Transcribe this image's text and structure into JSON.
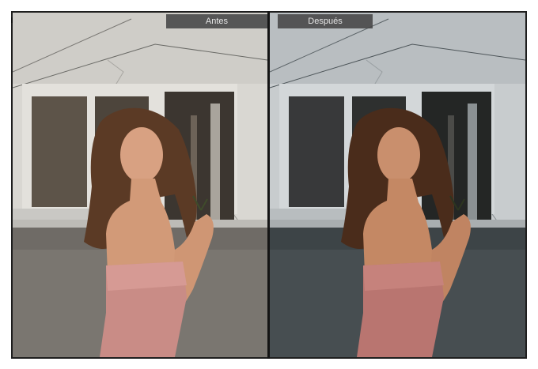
{
  "comparison": {
    "before_label": "Antes",
    "after_label": "Después"
  },
  "colors": {
    "frame": "#1e1e1e",
    "label_background": "#464646",
    "label_text": "#e6e6e6"
  }
}
